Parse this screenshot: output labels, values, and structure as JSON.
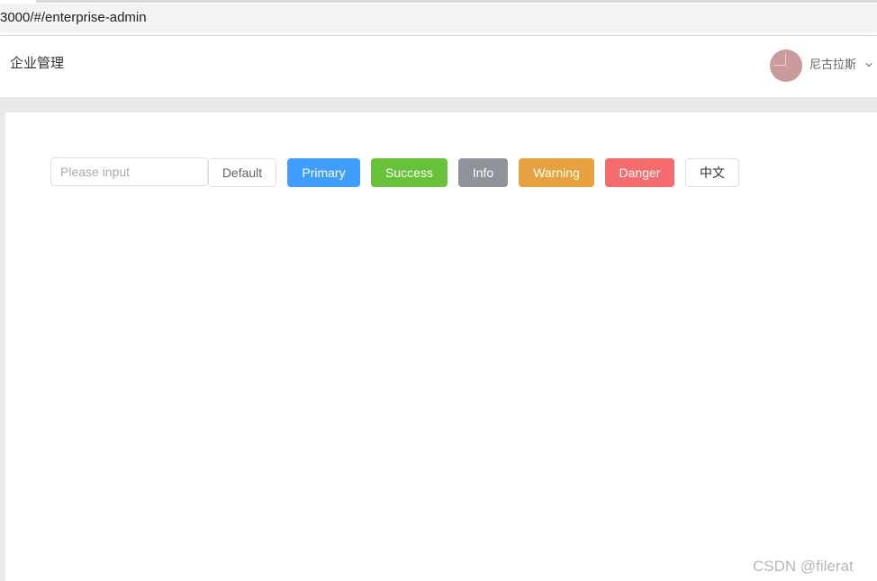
{
  "browser": {
    "url": "3000/#/enterprise-admin"
  },
  "header": {
    "title": "企业管理",
    "user": {
      "name": "尼古拉斯",
      "avatar_icon": "avatar-image",
      "dropdown_icon": "chevron-down-icon"
    }
  },
  "toolbar": {
    "input": {
      "value": "",
      "placeholder": "Please input"
    },
    "buttons": {
      "default": "Default",
      "primary": "Primary",
      "success": "Success",
      "info": "Info",
      "warning": "Warning",
      "danger": "Danger",
      "language": "中文"
    }
  },
  "colors": {
    "primary": "#409eff",
    "success": "#67c23a",
    "info": "#909399",
    "warning": "#e6a23c",
    "danger": "#f56c6c"
  },
  "watermark": "CSDN @filerat"
}
